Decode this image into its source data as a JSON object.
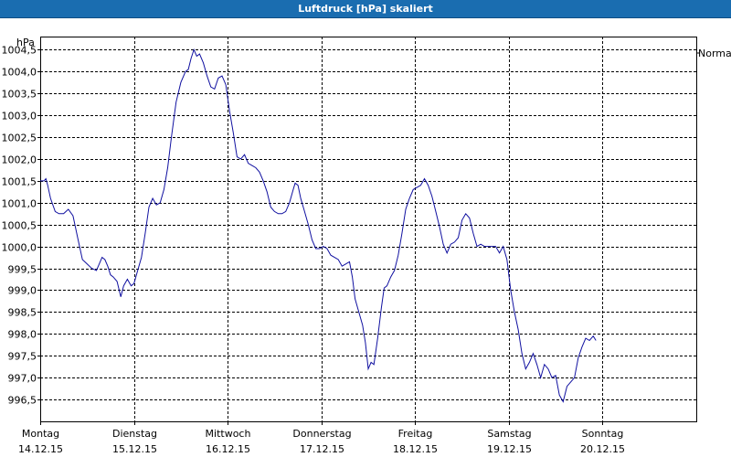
{
  "window": {
    "title": "Luftdruck [hPa] skaliert"
  },
  "chart_data": {
    "type": "line",
    "title": "Luftdruck [hPa] skaliert",
    "ylabel": "hPa",
    "xlabel": "",
    "ylim": [
      996.0,
      1004.8
    ],
    "xlim": [
      0,
      7
    ],
    "grid": true,
    "legend_position": "right",
    "y_ticks": [
      "1004,5",
      "1004,0",
      "1003,5",
      "1003,0",
      "1002,5",
      "1002,0",
      "1001,5",
      "1001,0",
      "1000,5",
      "1000,0",
      "999,5",
      "999,0",
      "998,5",
      "998,0",
      "997,5",
      "997,0",
      "996,5"
    ],
    "y_tick_values": [
      1004.5,
      1004.0,
      1003.5,
      1003.0,
      1002.5,
      1002.0,
      1001.5,
      1001.0,
      1000.5,
      1000.0,
      999.5,
      999.0,
      998.5,
      998.0,
      997.5,
      997.0,
      996.5
    ],
    "x_ticks": [
      {
        "day": "Montag",
        "date": "14.12.15",
        "x": 0
      },
      {
        "day": "Dienstag",
        "date": "15.12.15",
        "x": 1
      },
      {
        "day": "Mittwoch",
        "date": "16.12.15",
        "x": 2
      },
      {
        "day": "Donnerstag",
        "date": "17.12.15",
        "x": 3
      },
      {
        "day": "Freitag",
        "date": "18.12.15",
        "x": 4
      },
      {
        "day": "Samstag",
        "date": "19.12.15",
        "x": 5
      },
      {
        "day": "Sonntag",
        "date": "20.12.15",
        "x": 6
      }
    ],
    "series": [
      {
        "name": "Normal",
        "color": "#1010a0",
        "points": [
          [
            0.0,
            1001.5
          ],
          [
            0.04,
            1001.5
          ],
          [
            0.06,
            1001.55
          ],
          [
            0.08,
            1001.4
          ],
          [
            0.11,
            1001.1
          ],
          [
            0.16,
            1000.8
          ],
          [
            0.2,
            1000.75
          ],
          [
            0.25,
            1000.75
          ],
          [
            0.3,
            1000.85
          ],
          [
            0.35,
            1000.7
          ],
          [
            0.4,
            1000.2
          ],
          [
            0.45,
            999.7
          ],
          [
            0.5,
            999.6
          ],
          [
            0.55,
            999.5
          ],
          [
            0.6,
            999.45
          ],
          [
            0.63,
            999.6
          ],
          [
            0.66,
            999.75
          ],
          [
            0.69,
            999.7
          ],
          [
            0.72,
            999.55
          ],
          [
            0.75,
            999.35
          ],
          [
            0.78,
            999.3
          ],
          [
            0.82,
            999.2
          ],
          [
            0.86,
            998.85
          ],
          [
            0.89,
            999.1
          ],
          [
            0.93,
            999.25
          ],
          [
            0.97,
            999.1
          ],
          [
            1.0,
            999.15
          ],
          [
            1.04,
            999.45
          ],
          [
            1.08,
            999.75
          ],
          [
            1.12,
            1000.3
          ],
          [
            1.16,
            1000.9
          ],
          [
            1.2,
            1001.1
          ],
          [
            1.24,
            1000.95
          ],
          [
            1.28,
            1001.0
          ],
          [
            1.32,
            1001.3
          ],
          [
            1.36,
            1001.8
          ],
          [
            1.4,
            1002.5
          ],
          [
            1.45,
            1003.3
          ],
          [
            1.5,
            1003.75
          ],
          [
            1.55,
            1004.0
          ],
          [
            1.58,
            1004.05
          ],
          [
            1.61,
            1004.3
          ],
          [
            1.64,
            1004.5
          ],
          [
            1.67,
            1004.35
          ],
          [
            1.7,
            1004.4
          ],
          [
            1.74,
            1004.2
          ],
          [
            1.78,
            1003.9
          ],
          [
            1.82,
            1003.65
          ],
          [
            1.86,
            1003.6
          ],
          [
            1.9,
            1003.85
          ],
          [
            1.94,
            1003.9
          ],
          [
            1.98,
            1003.7
          ],
          [
            2.02,
            1003.1
          ],
          [
            2.06,
            1002.6
          ],
          [
            2.1,
            1002.05
          ],
          [
            2.14,
            1002.0
          ],
          [
            2.18,
            1002.1
          ],
          [
            2.22,
            1001.9
          ],
          [
            2.26,
            1001.85
          ],
          [
            2.3,
            1001.8
          ],
          [
            2.34,
            1001.7
          ],
          [
            2.38,
            1001.5
          ],
          [
            2.42,
            1001.25
          ],
          [
            2.46,
            1000.9
          ],
          [
            2.5,
            1000.8
          ],
          [
            2.54,
            1000.75
          ],
          [
            2.58,
            1000.75
          ],
          [
            2.62,
            1000.8
          ],
          [
            2.66,
            1001.0
          ],
          [
            2.7,
            1001.3
          ],
          [
            2.72,
            1001.45
          ],
          [
            2.75,
            1001.4
          ],
          [
            2.78,
            1001.1
          ],
          [
            2.82,
            1000.8
          ],
          [
            2.86,
            1000.5
          ],
          [
            2.9,
            1000.15
          ],
          [
            2.94,
            999.95
          ],
          [
            2.98,
            999.95
          ],
          [
            3.02,
            1000.0
          ],
          [
            3.06,
            999.95
          ],
          [
            3.1,
            999.8
          ],
          [
            3.14,
            999.75
          ],
          [
            3.18,
            999.7
          ],
          [
            3.22,
            999.55
          ],
          [
            3.26,
            999.6
          ],
          [
            3.3,
            999.65
          ],
          [
            3.33,
            999.3
          ],
          [
            3.36,
            998.8
          ],
          [
            3.4,
            998.5
          ],
          [
            3.44,
            998.2
          ],
          [
            3.47,
            997.8
          ],
          [
            3.5,
            997.2
          ],
          [
            3.53,
            997.35
          ],
          [
            3.56,
            997.3
          ],
          [
            3.6,
            997.9
          ],
          [
            3.64,
            998.6
          ],
          [
            3.67,
            999.05
          ],
          [
            3.7,
            999.1
          ],
          [
            3.74,
            999.3
          ],
          [
            3.78,
            999.45
          ],
          [
            3.82,
            999.8
          ],
          [
            3.86,
            1000.3
          ],
          [
            3.9,
            1000.85
          ],
          [
            3.94,
            1001.1
          ],
          [
            3.98,
            1001.3
          ],
          [
            4.02,
            1001.35
          ],
          [
            4.06,
            1001.4
          ],
          [
            4.1,
            1001.55
          ],
          [
            4.14,
            1001.4
          ],
          [
            4.18,
            1001.15
          ],
          [
            4.22,
            1000.8
          ],
          [
            4.26,
            1000.45
          ],
          [
            4.3,
            1000.05
          ],
          [
            4.34,
            999.85
          ],
          [
            4.38,
            1000.05
          ],
          [
            4.42,
            1000.1
          ],
          [
            4.46,
            1000.2
          ],
          [
            4.5,
            1000.6
          ],
          [
            4.54,
            1000.75
          ],
          [
            4.58,
            1000.65
          ],
          [
            4.62,
            1000.3
          ],
          [
            4.66,
            1000.0
          ],
          [
            4.7,
            1000.05
          ],
          [
            4.74,
            1000.0
          ],
          [
            4.78,
            1000.0
          ],
          [
            4.82,
            1000.0
          ],
          [
            4.86,
            1000.0
          ],
          [
            4.9,
            999.85
          ],
          [
            4.94,
            1000.0
          ],
          [
            4.98,
            999.7
          ],
          [
            5.02,
            999.0
          ],
          [
            5.06,
            998.5
          ],
          [
            5.1,
            998.1
          ],
          [
            5.14,
            997.55
          ],
          [
            5.18,
            997.2
          ],
          [
            5.22,
            997.35
          ],
          [
            5.26,
            997.55
          ],
          [
            5.3,
            997.3
          ],
          [
            5.34,
            997.0
          ],
          [
            5.38,
            997.3
          ],
          [
            5.42,
            997.2
          ],
          [
            5.46,
            997.0
          ],
          [
            5.5,
            997.05
          ],
          [
            5.54,
            996.6
          ],
          [
            5.58,
            996.45
          ],
          [
            5.62,
            996.8
          ],
          [
            5.66,
            996.9
          ],
          [
            5.7,
            997.0
          ],
          [
            5.74,
            997.45
          ],
          [
            5.78,
            997.7
          ],
          [
            5.82,
            997.9
          ],
          [
            5.86,
            997.85
          ],
          [
            5.9,
            997.95
          ],
          [
            5.93,
            997.85
          ]
        ]
      }
    ]
  }
}
